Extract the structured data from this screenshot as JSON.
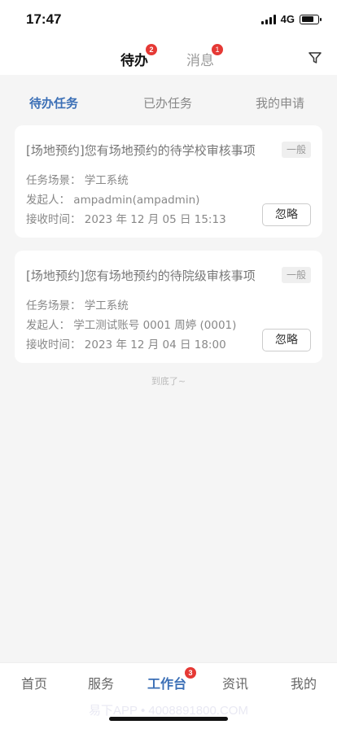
{
  "status_bar": {
    "time": "17:47",
    "network": "4G"
  },
  "header": {
    "tabs": [
      {
        "label": "待办",
        "badge": "2"
      },
      {
        "label": "消息",
        "badge": "1"
      }
    ]
  },
  "sub_tabs": [
    {
      "label": "待办任务",
      "active": true
    },
    {
      "label": "已办任务",
      "active": false
    },
    {
      "label": "我的申请",
      "active": false
    }
  ],
  "tasks": [
    {
      "title": "[场地预约]您有场地预约的待学校审核事项",
      "tag": "一般",
      "scene": "任务场景：  学工系统",
      "initiator": "发起人：  ampadmin(ampadmin)",
      "received": "接收时间：  2023 年 12 月 05 日 15:13",
      "ignore_label": "忽略"
    },
    {
      "title": "[场地预约]您有场地预约的待院级审核事项",
      "tag": "一般",
      "scene": "任务场景：  学工系统",
      "initiator": "发起人：  学工测试账号 0001 周婷 (0001)",
      "received": "接收时间：  2023 年 12 月 04 日 18:00",
      "ignore_label": "忽略"
    }
  ],
  "list_end_text": "到底了~",
  "bottom_nav": [
    {
      "label": "首页"
    },
    {
      "label": "服务"
    },
    {
      "label": "工作台",
      "badge": "3",
      "active": true
    },
    {
      "label": "资讯"
    },
    {
      "label": "我的"
    }
  ],
  "watermark": "易下APP • 4008891800.COM",
  "colors": {
    "accent": "#3b6fb6",
    "badge": "#e53935",
    "background": "#f5f5f5"
  },
  "icons": {
    "filter": "filter-icon"
  }
}
